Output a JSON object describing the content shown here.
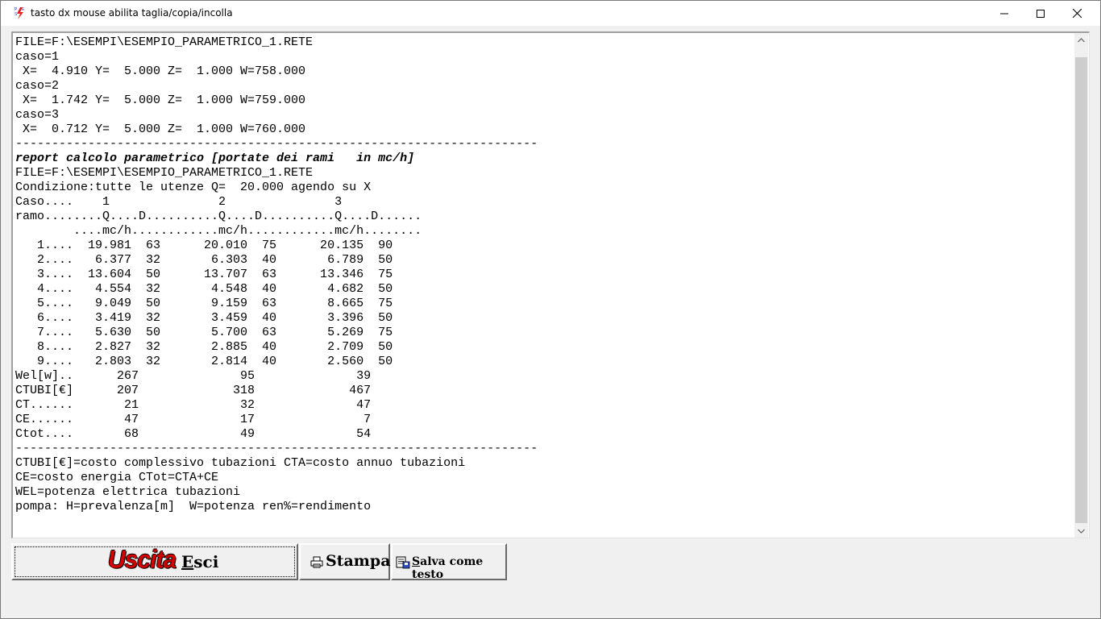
{
  "window": {
    "title": "tasto dx mouse abilita taglia/copia/incolla",
    "app_icon": "pse-app-icon",
    "controls": [
      "minimize-icon",
      "maximize-icon",
      "close-icon"
    ]
  },
  "report": {
    "lines": [
      "FILE=F:\\ESEMPI\\ESEMPIO_PARAMETRICO_1.RETE",
      "caso=1",
      " X=  4.910 Y=  5.000 Z=  1.000 W=758.000",
      "caso=2",
      " X=  1.742 Y=  5.000 Z=  1.000 W=759.000",
      "caso=3",
      " X=  0.712 Y=  5.000 Z=  1.000 W=760.000",
      "------------------------------------------------------------------------",
      "report calcolo parametrico [portate dei rami   in mc/h]",
      "FILE=F:\\ESEMPI\\ESEMPIO_PARAMETRICO_1.RETE",
      "Condizione:tutte le utenze Q=  20.000 agendo su X",
      "Caso....    1               2               3",
      "ramo........Q....D..........Q....D..........Q....D......",
      "        ....mc/h............mc/h............mc/h........",
      "   1....  19.981  63      20.010  75      20.135  90",
      "   2....   6.377  32       6.303  40       6.789  50",
      "   3....  13.604  50      13.707  63      13.346  75",
      "   4....   4.554  32       4.548  40       4.682  50",
      "   5....   9.049  50       9.159  63       8.665  75",
      "   6....   3.419  32       3.459  40       3.396  50",
      "   7....   5.630  50       5.700  63       5.269  75",
      "   8....   2.827  32       2.885  40       2.709  50",
      "   9....   2.803  32       2.814  40       2.560  50",
      "Wel[w]..      267              95              39",
      "CTUBI[€]      207             318             467",
      "CT......       21              32              47",
      "CE......       47              17               7",
      "Ctot....       68              49              54",
      "------------------------------------------------------------------------",
      "CTUBI[€]=costo complessivo tubazioni CTA=costo annuo tubazioni",
      "CE=costo energia CTot=CTA+CE",
      "WEL=potenza elettrica tubazioni",
      "pompa: H=prevalenza[m]  W=potenza ren%=rendimento"
    ],
    "bold_line_index": 8
  },
  "buttons": {
    "esci_logo": "Uscita",
    "esci_accel": "E",
    "esci_rest": "sci",
    "stampa_label": "Stampa",
    "stampa_icon": "printer-icon",
    "salva_accel": "S",
    "salva_rest": "alva come testo",
    "salva_icon": "save-document-icon"
  },
  "colors": {
    "logo_red": "#d40000",
    "scroll_thumb": "#cdcdcd"
  }
}
